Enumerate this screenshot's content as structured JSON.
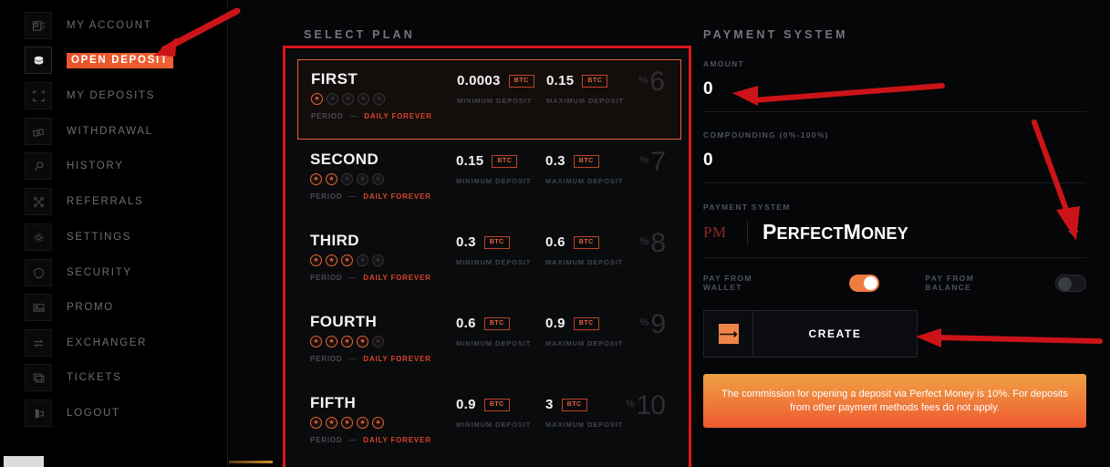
{
  "sidebar": {
    "items": [
      {
        "label": "MY ACCOUNT",
        "icon": "account-card-icon",
        "active": false
      },
      {
        "label": "OPEN DEPOSIT",
        "icon": "coins-icon",
        "active": true
      },
      {
        "label": "MY DEPOSITS",
        "icon": "frame-brackets-icon",
        "active": false
      },
      {
        "label": "WITHDRAWAL",
        "icon": "banknotes-icon",
        "active": false
      },
      {
        "label": "HISTORY",
        "icon": "magnifier-icon",
        "active": false
      },
      {
        "label": "REFERRALS",
        "icon": "network-nodes-icon",
        "active": false
      },
      {
        "label": "SETTINGS",
        "icon": "gear-icon",
        "active": false
      },
      {
        "label": "SECURITY",
        "icon": "shield-icon",
        "active": false
      },
      {
        "label": "PROMO",
        "icon": "image-card-icon",
        "active": false
      },
      {
        "label": "EXCHANGER",
        "icon": "exchange-arrows-icon",
        "active": false
      },
      {
        "label": "TICKETS",
        "icon": "ticket-stack-icon",
        "active": false
      },
      {
        "label": "LOGOUT",
        "icon": "logout-door-icon",
        "active": false
      }
    ]
  },
  "plans_panel": {
    "title": "SELECT PLAN",
    "min_caption": "MINIMUM DEPOSIT",
    "max_caption": "MAXIMUM DEPOSIT",
    "period_label": "PERIOD",
    "period_dash": "—",
    "percent_sign": "%",
    "currency_badge": "BTC",
    "plans": [
      {
        "name": "FIRST",
        "stars_filled": 1,
        "stars_total": 5,
        "period_value": "DAILY FOREVER",
        "min": "0.0003",
        "max": "0.15",
        "percent": "6",
        "selected": true
      },
      {
        "name": "SECOND",
        "stars_filled": 2,
        "stars_total": 5,
        "period_value": "DAILY FOREVER",
        "min": "0.15",
        "max": "0.3",
        "percent": "7",
        "selected": false
      },
      {
        "name": "THIRD",
        "stars_filled": 3,
        "stars_total": 5,
        "period_value": "DAILY FOREVER",
        "min": "0.3",
        "max": "0.6",
        "percent": "8",
        "selected": false
      },
      {
        "name": "FOURTH",
        "stars_filled": 4,
        "stars_total": 5,
        "period_value": "DAILY FOREVER",
        "min": "0.6",
        "max": "0.9",
        "percent": "9",
        "selected": false
      },
      {
        "name": "FIFTH",
        "stars_filled": 5,
        "stars_total": 5,
        "period_value": "DAILY FOREVER",
        "min": "0.9",
        "max": "3",
        "percent": "10",
        "selected": false
      }
    ]
  },
  "payment_panel": {
    "title": "PAYMENT SYSTEM",
    "amount_label": "AMOUNT",
    "amount_value": "0",
    "compounding_label": "COMPOUNDING (0%-100%)",
    "compounding_value": "0",
    "payment_system_label": "PAYMENT SYSTEM",
    "selected_system_short": "PM",
    "selected_system_name": "PerfectMoney",
    "dropdown_icon": "chevron-down-icon",
    "pay_from_wallet_label": "PAY FROM WALLET",
    "pay_from_wallet_on": true,
    "pay_from_balance_label": "PAY FROM BALANCE",
    "pay_from_balance_on": false,
    "create_label": "CREATE",
    "create_icon": "arrow-right-icon",
    "commission_notice": "The commission for opening a deposit via Perfect Money is 10%. For deposits from other payment methods fees do not apply."
  },
  "annotations": {
    "highlight_color": "#e0161b",
    "arrow_color": "#cc1418",
    "arrows": [
      {
        "name": "arrow-to-open-deposit"
      },
      {
        "name": "arrow-to-amount-field"
      },
      {
        "name": "arrow-to-payment-dropdown"
      },
      {
        "name": "arrow-to-create-button"
      }
    ]
  }
}
